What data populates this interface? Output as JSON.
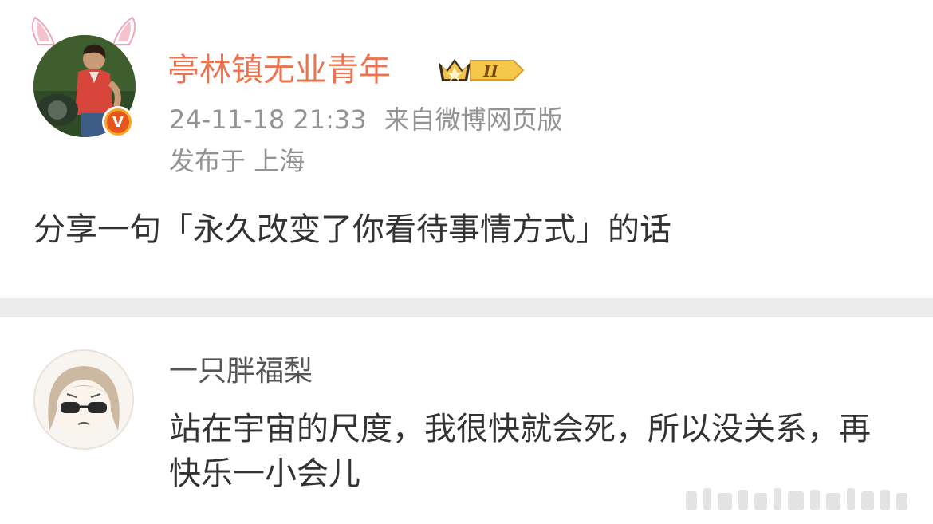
{
  "post": {
    "author_name": "亭林镇无业青年",
    "member_level": "II",
    "timestamp": "24-11-18 21:33",
    "source": "来自微博网页版",
    "location": "发布于 上海",
    "text": "分享一句「永久改变了你看待事情方式」的话",
    "verified_badge": "V"
  },
  "comment": {
    "author_name": "一只胖福梨",
    "text": "站在宇宙的尺度，我很快就会死，所以没关系，再快乐一小会儿"
  },
  "colors": {
    "author_name": "#eb7350",
    "meta_gray": "#939393",
    "divider": "#ececec",
    "text": "#333333"
  },
  "icons": [
    "bunny-ears-icon",
    "verified-v-icon",
    "crown-member-icon"
  ]
}
